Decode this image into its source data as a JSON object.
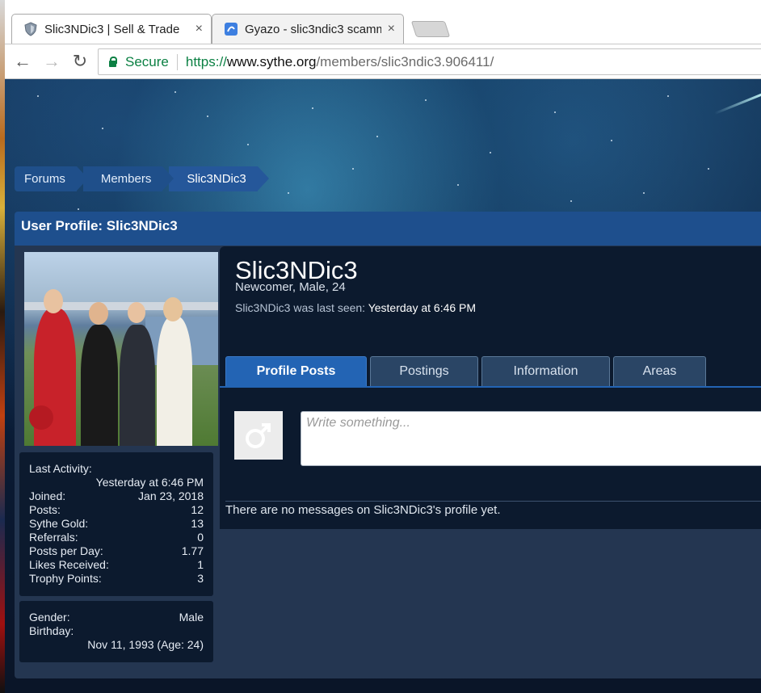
{
  "browser": {
    "tabs": [
      {
        "title": "Slic3NDic3 | Sell & Trade",
        "close": "×",
        "active": true
      },
      {
        "title": "Gyazo - slic3ndic3 scamm",
        "close": "×",
        "active": false
      }
    ],
    "nav": {
      "back": "←",
      "forward": "→",
      "reload": "↻"
    },
    "omnibox": {
      "secure_label": "Secure",
      "url_scheme": "https://",
      "url_host": "www.sythe.org",
      "url_path": "/members/slic3ndic3.906411/"
    }
  },
  "breadcrumb": [
    "Forums",
    "Members",
    "Slic3NDic3"
  ],
  "profile": {
    "header": "User Profile: Slic3NDic3",
    "username": "Slic3NDic3",
    "user_title": "Newcomer, Male, 24",
    "last_seen_label": "Slic3NDic3 was last seen:",
    "last_seen_value": "Yesterday at 6:46 PM",
    "stats": {
      "last_activity_label": "Last Activity:",
      "last_activity_value": "Yesterday at 6:46 PM",
      "joined_label": "Joined:",
      "joined_value": "Jan 23, 2018",
      "posts_label": "Posts:",
      "posts_value": "12",
      "sythe_gold_label": "Sythe Gold:",
      "sythe_gold_value": "13",
      "referrals_label": "Referrals:",
      "referrals_value": "0",
      "posts_per_day_label": "Posts per Day:",
      "posts_per_day_value": "1.77",
      "likes_label": "Likes Received:",
      "likes_value": "1",
      "trophy_label": "Trophy Points:",
      "trophy_value": "3"
    },
    "info": {
      "gender_label": "Gender:",
      "gender_value": "Male",
      "birthday_label": "Birthday:",
      "birthday_value": "Nov 11, 1993 (Age: 24)"
    },
    "tabs": [
      "Profile Posts",
      "Postings",
      "Information",
      "Areas"
    ],
    "post_placeholder": "Write something...",
    "no_messages": "There are no messages on Slic3NDic3's profile yet."
  },
  "colors": {
    "accent": "#2364b4",
    "header": "#1e4f8d",
    "panel": "#0c1a2e",
    "secure": "#0b8043"
  }
}
